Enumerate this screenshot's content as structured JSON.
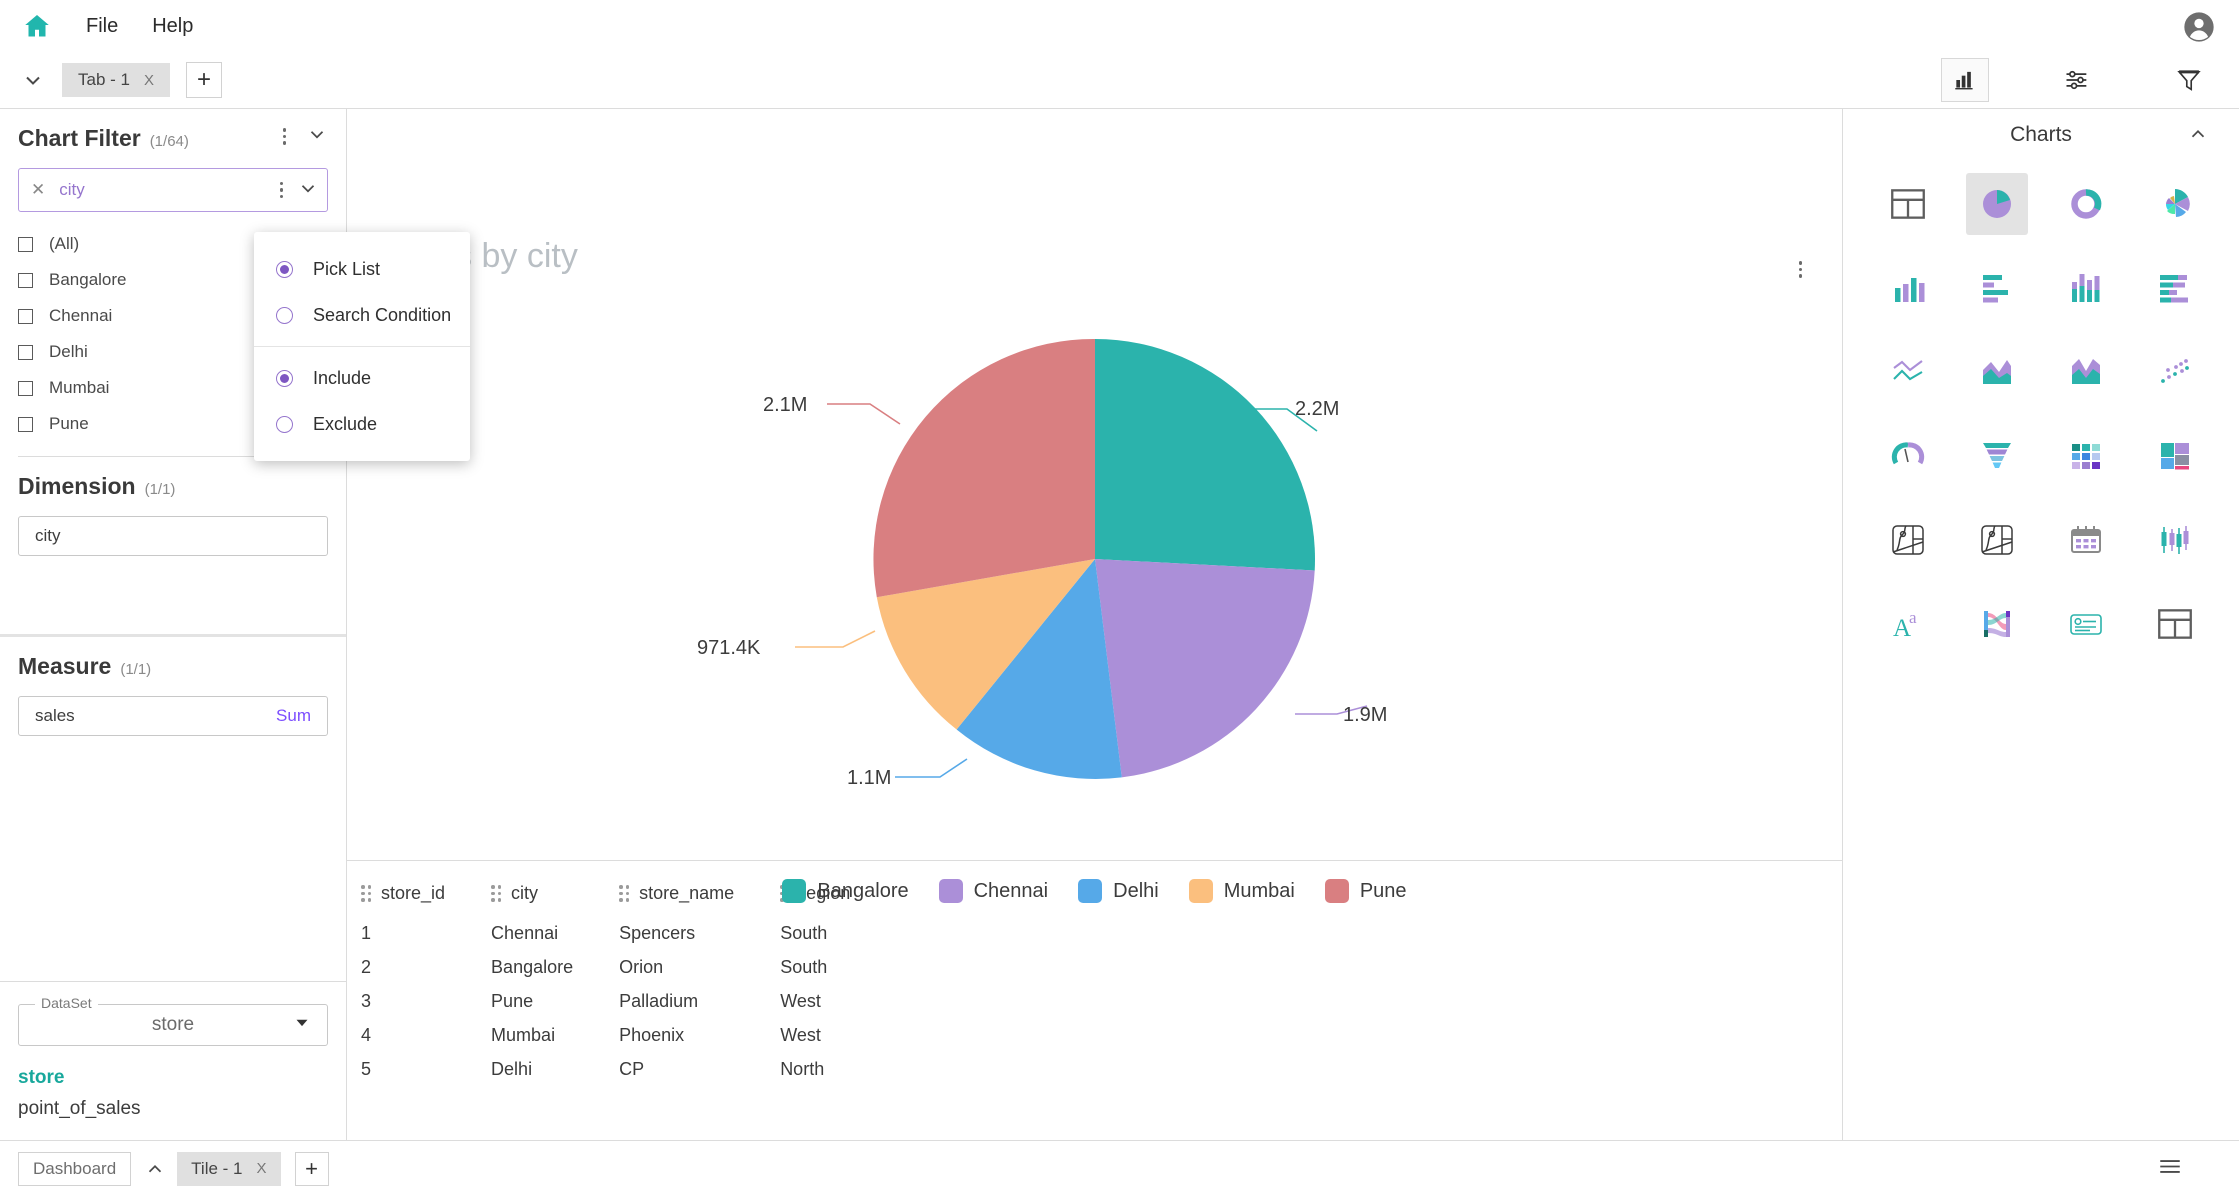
{
  "menubar": {
    "home_icon": "home-icon",
    "items": [
      {
        "label": "File"
      },
      {
        "label": "Help"
      }
    ],
    "avatar_icon": "account-circle-icon"
  },
  "tabbar": {
    "collapse_icon": "chevron-down-icon",
    "tab_label": "Tab - 1",
    "tab_close": "X",
    "add_tab": "+",
    "tools": [
      {
        "name": "chart-view-icon",
        "active": true
      },
      {
        "name": "settings-sliders-icon",
        "active": false
      },
      {
        "name": "filter-funnel-icon",
        "active": false
      }
    ]
  },
  "left_panel": {
    "chart_filter": {
      "title": "Chart Filter",
      "count": "(1/64)",
      "kebab_icon": "more-options-icon",
      "collapse_icon": "chevron-down-icon",
      "field": {
        "clear_icon": "close-icon",
        "label": "city",
        "kebab_icon": "more-options-icon",
        "caret_icon": "chevron-down-icon"
      },
      "options": [
        {
          "label": "(All)",
          "checked": false
        },
        {
          "label": "Bangalore",
          "checked": false
        },
        {
          "label": "Chennai",
          "checked": false
        },
        {
          "label": "Delhi",
          "checked": false
        },
        {
          "label": "Mumbai",
          "checked": false
        },
        {
          "label": "Pune",
          "checked": false
        }
      ]
    },
    "dimension": {
      "title": "Dimension",
      "count": "(1/1)",
      "items": [
        {
          "label": "city"
        }
      ]
    },
    "measure": {
      "title": "Measure",
      "count": "(1/1)",
      "items": [
        {
          "label": "sales",
          "agg": "Sum"
        }
      ]
    },
    "dataset": {
      "legend": "DataSet",
      "value": "store",
      "caret_icon": "dropdown-caret-icon",
      "tables": [
        {
          "label": "store",
          "selected": true
        },
        {
          "label": "point_of_sales",
          "selected": false
        }
      ]
    }
  },
  "popup_menu": {
    "groups": [
      {
        "items": [
          {
            "label": "Pick List",
            "selected": true
          },
          {
            "label": "Search Condition",
            "selected": false
          }
        ]
      },
      {
        "items": [
          {
            "label": "Include",
            "selected": true
          },
          {
            "label": "Exclude",
            "selected": false
          }
        ]
      }
    ]
  },
  "chart": {
    "title": "Sales by city",
    "kebab_icon": "more-options-icon"
  },
  "chart_data": {
    "type": "pie",
    "title": "Sales by city",
    "xlabel": "",
    "ylabel": "",
    "categories": [
      "Bangalore",
      "Chennai",
      "Delhi",
      "Mumbai",
      "Pune"
    ],
    "values": [
      2200000,
      1900000,
      1100000,
      971400,
      2100000
    ],
    "labels": [
      "2.2M",
      "1.9M",
      "1.1M",
      "971.4K",
      "2.1M"
    ],
    "colors": [
      "#2bb3ac",
      "#ab8fd8",
      "#56a9e8",
      "#fbbf7e",
      "#d97f81"
    ],
    "legend_position": "bottom",
    "grid": false,
    "measure": "sales",
    "aggregation": "Sum",
    "dimension": "city"
  },
  "data_grid": {
    "columns": [
      "store_id",
      "city",
      "store_name",
      "region"
    ],
    "rows": [
      [
        "1",
        "Chennai",
        "Spencers",
        "South"
      ],
      [
        "2",
        "Bangalore",
        "Orion",
        "South"
      ],
      [
        "3",
        "Pune",
        "Palladium",
        "West"
      ],
      [
        "4",
        "Mumbai",
        "Phoenix",
        "West"
      ],
      [
        "5",
        "Delhi",
        "CP",
        "North"
      ]
    ]
  },
  "right_panel": {
    "title": "Charts",
    "collapse_icon": "chevron-up-icon",
    "icons": [
      {
        "name": "table-grid-icon",
        "selected": false
      },
      {
        "name": "pie-chart-icon",
        "selected": true
      },
      {
        "name": "donut-chart-icon",
        "selected": false
      },
      {
        "name": "rose-chart-icon",
        "selected": false
      },
      {
        "name": "column-chart-icon",
        "selected": false
      },
      {
        "name": "bar-chart-icon",
        "selected": false
      },
      {
        "name": "stacked-column-chart-icon",
        "selected": false
      },
      {
        "name": "stacked-bar-chart-icon",
        "selected": false
      },
      {
        "name": "line-chart-icon",
        "selected": false
      },
      {
        "name": "area-chart-icon",
        "selected": false
      },
      {
        "name": "stacked-area-chart-icon",
        "selected": false
      },
      {
        "name": "scatter-plot-icon",
        "selected": false
      },
      {
        "name": "gauge-chart-icon",
        "selected": false
      },
      {
        "name": "funnel-chart-icon",
        "selected": false
      },
      {
        "name": "heatmap-icon",
        "selected": false
      },
      {
        "name": "treemap-icon",
        "selected": false
      },
      {
        "name": "map-chart-icon",
        "selected": false
      },
      {
        "name": "filled-map-chart-icon",
        "selected": false
      },
      {
        "name": "calendar-chart-icon",
        "selected": false
      },
      {
        "name": "candlestick-chart-icon",
        "selected": false
      },
      {
        "name": "word-cloud-icon",
        "selected": false
      },
      {
        "name": "sankey-chart-icon",
        "selected": false
      },
      {
        "name": "kpi-card-icon",
        "selected": false
      },
      {
        "name": "pivot-table-icon",
        "selected": false
      }
    ]
  },
  "bottom_bar": {
    "dashboard_label": "Dashboard",
    "expand_icon": "chevron-up-icon",
    "tile_label": "Tile - 1",
    "tile_close": "X",
    "add_tile": "+",
    "menu_icon": "hamburger-menu-icon"
  },
  "colors": {
    "accent_teal": "#18a89c",
    "accent_purple": "#7e57c2",
    "border": "#dcdcdc"
  }
}
